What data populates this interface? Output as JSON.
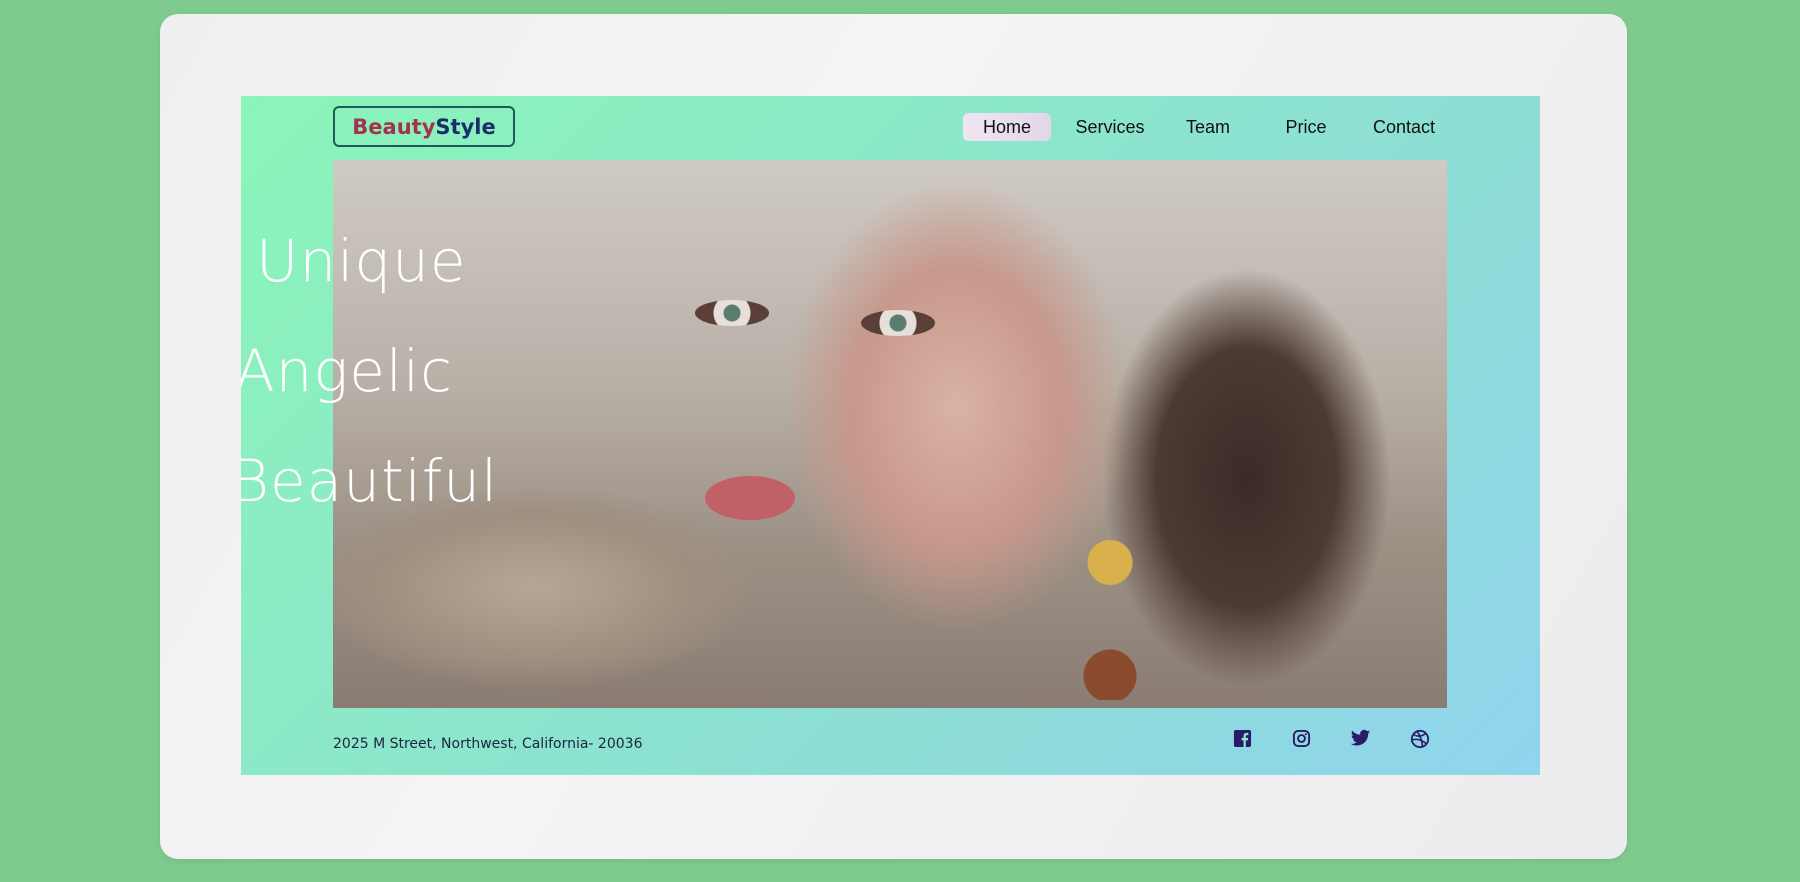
{
  "brand": {
    "part1": "Beauty",
    "part2": "Style"
  },
  "nav": {
    "items": [
      {
        "label": "Home",
        "active": true
      },
      {
        "label": "Services",
        "active": false
      },
      {
        "label": "Team",
        "active": false
      },
      {
        "label": "Price",
        "active": false
      },
      {
        "label": "Contact",
        "active": false
      }
    ]
  },
  "hero": {
    "words": [
      "Unique",
      "Angelic",
      "Beautiful"
    ]
  },
  "footer": {
    "address": "2025 M Street, Northwest, California- 20036",
    "social": [
      {
        "icon": "facebook-icon"
      },
      {
        "icon": "instagram-icon"
      },
      {
        "icon": "twitter-icon"
      },
      {
        "icon": "dribbble-icon"
      }
    ]
  },
  "colors": {
    "outer_bg": "#7fca8f",
    "brand_primary": "#a2324f",
    "brand_secondary": "#1a2e6c",
    "icon_color": "#2a1a6a"
  }
}
